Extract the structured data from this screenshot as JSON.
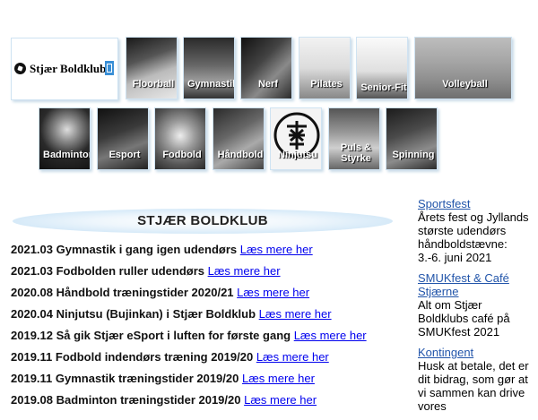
{
  "logo": {
    "name": "Stjær Boldklub"
  },
  "tiles_row1": [
    "Floorball",
    "Gymnastik",
    "Nerf",
    "Pilates",
    "Senior-Fit",
    "Volleyball"
  ],
  "tiles_row2": [
    "Badminton",
    "Esport",
    "Fodbold",
    "Håndbold",
    "Ninjutsu",
    "Puls & Styrke",
    "Spinning"
  ],
  "banner": {
    "title": "STJÆR BOLDKLUB"
  },
  "news": [
    {
      "text": "2021.03 Gymnastik i gang igen udendørs",
      "link": "Læs mere her"
    },
    {
      "text": "2021.03 Fodbolden ruller udendørs",
      "link": "Læs mere her"
    },
    {
      "text": "2020.08 Håndbold træningstider 2020/21",
      "link": "Læs mere her"
    },
    {
      "text": "2020.04 Ninjutsu (Bujinkan) i Stjær Boldklub",
      "link": "Læs mere her"
    },
    {
      "text": "2019.12 Så gik Stjær eSport i luften for første gang",
      "link": "Læs mere her"
    },
    {
      "text": "2019.11 Fodbold indendørs træning 2019/20",
      "link": "Læs mere her"
    },
    {
      "text": "2019.11 Gymnastik træningstider 2019/20",
      "link": "Læs mere her"
    },
    {
      "text": "2019.08 Badminton træningstider 2019/20",
      "link": "Læs mere her"
    }
  ],
  "sidebar": [
    {
      "title": "Sportsfest",
      "body": "Årets fest og Jyllands største udendørs håndboldstævne: 3.-6. juni 2021"
    },
    {
      "title": "SMUKfest & Café Stjærne",
      "body": "Alt om Stjær Boldklubs café på SMUKfest 2021"
    },
    {
      "title": "Kontingent",
      "body": "Husk at betale, det er dit bidrag, som gør at vi sammen kan drive vores"
    }
  ]
}
